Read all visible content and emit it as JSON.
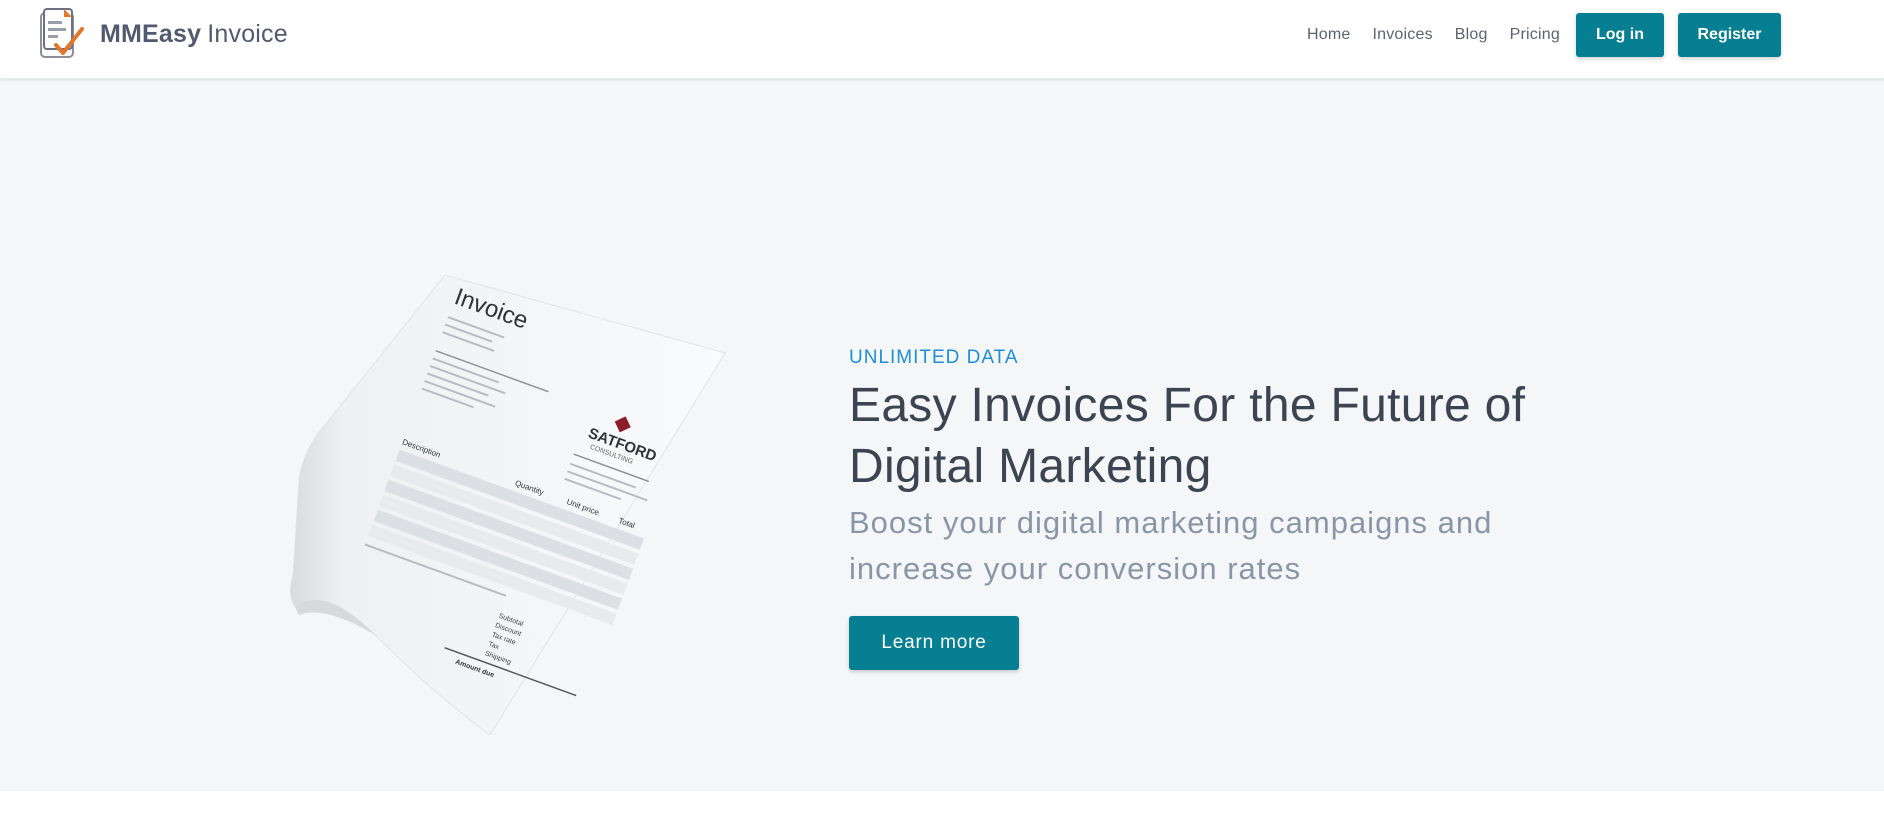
{
  "brand": {
    "name_strong": "MMEasy",
    "name_light": "Invoice",
    "logo_icon": "invoice-checkmark-logo"
  },
  "nav": {
    "links": [
      {
        "label": "Home"
      },
      {
        "label": "Invoices"
      },
      {
        "label": "Blog"
      },
      {
        "label": "Pricing"
      }
    ],
    "login_label": "Log in",
    "register_label": "Register"
  },
  "hero": {
    "eyebrow": "UNLIMITED DATA",
    "headline_light": "Easy Invoices For the ",
    "headline_bold": "Future of Digital Marketing",
    "subhead": "Boost your digital marketing campaigns and increase your conversion rates",
    "cta_label": "Learn more",
    "image": {
      "title": "Invoice",
      "company": "SATFORD",
      "company_sub": "CONSULTING",
      "columns": [
        "Description",
        "Quantity",
        "Unit price",
        "Total"
      ],
      "totals": [
        "Subtotal",
        "Discount",
        "Tax rate",
        "Tax",
        "Shipping",
        "Amount due"
      ]
    }
  },
  "colors": {
    "accent": "#067f92",
    "eyebrow": "#1e8fd3",
    "hero_bg": "#f4f6f8",
    "heading": "#3d4451",
    "subtext": "#8a96a8"
  }
}
